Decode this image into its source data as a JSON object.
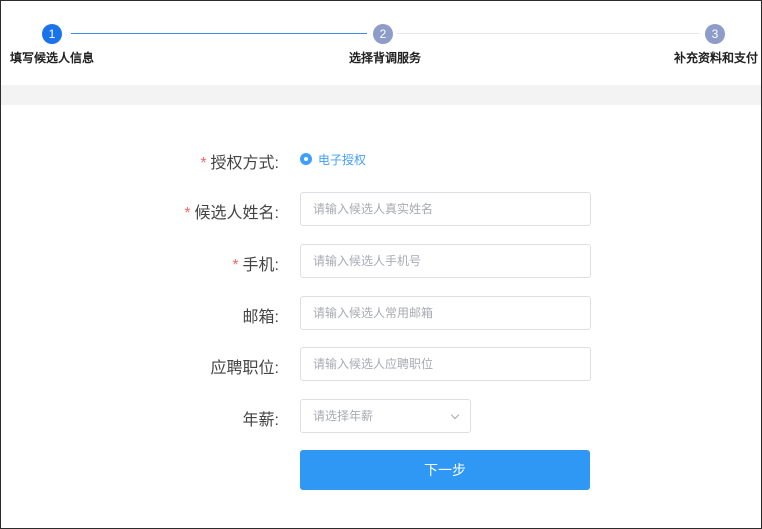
{
  "steps": [
    {
      "number": "1",
      "title": "填写候选人信息"
    },
    {
      "number": "2",
      "title": "选择背调服务"
    },
    {
      "number": "3",
      "title": "补充资料和支付"
    }
  ],
  "form": {
    "auth_method": {
      "required_mark": "*",
      "label": "授权方式:",
      "option": "电子授权",
      "selected": true
    },
    "name": {
      "required_mark": "*",
      "label": "候选人姓名:",
      "placeholder": "请输入候选人真实姓名"
    },
    "phone": {
      "required_mark": "*",
      "label": "手机:",
      "placeholder": "请输入候选人手机号"
    },
    "email": {
      "label": "邮箱:",
      "placeholder": "请输入候选人常用邮箱"
    },
    "position": {
      "label": "应聘职位:",
      "placeholder": "请输入候选人应聘职位"
    },
    "salary": {
      "label": "年薪:",
      "placeholder": "请选择年薪"
    },
    "next_button": "下一步"
  },
  "colors": {
    "accent": "#409eff",
    "step_active": "#1a73e8",
    "step_inactive": "#8e9cc9",
    "required": "#f56c6c",
    "button": "#2f97f4"
  }
}
